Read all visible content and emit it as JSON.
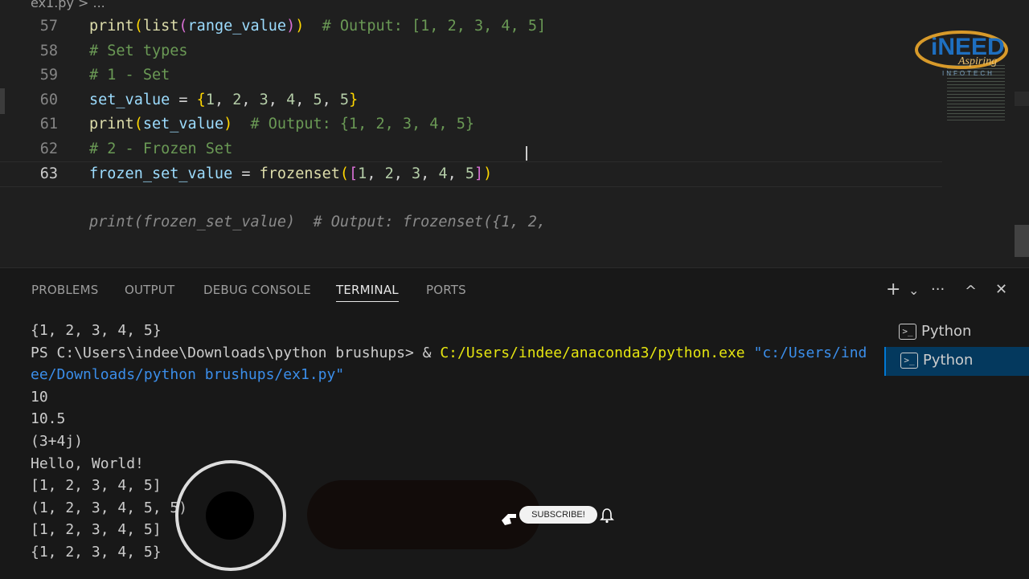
{
  "editor": {
    "tab_label": "ex1.py > ...",
    "lines": [
      {
        "n": "57",
        "segs": [
          [
            "fn",
            "print"
          ],
          [
            "p1",
            "("
          ],
          [
            "fn",
            "list"
          ],
          [
            "p2",
            "("
          ],
          [
            "var",
            "range_value"
          ],
          [
            "p2",
            ")"
          ],
          [
            "p1",
            ")"
          ],
          [
            "op",
            "  "
          ],
          [
            "cm",
            "# Output: [1, 2, 3, 4, 5]"
          ]
        ]
      },
      {
        "n": "58",
        "segs": [
          [
            "cm",
            "# Set types"
          ]
        ]
      },
      {
        "n": "59",
        "segs": [
          [
            "cm",
            "# 1 - Set"
          ]
        ]
      },
      {
        "n": "60",
        "segs": [
          [
            "var",
            "set_value"
          ],
          [
            "op",
            " = "
          ],
          [
            "p1",
            "{"
          ],
          [
            "num",
            "1"
          ],
          [
            "op",
            ", "
          ],
          [
            "num",
            "2"
          ],
          [
            "op",
            ", "
          ],
          [
            "num",
            "3"
          ],
          [
            "op",
            ", "
          ],
          [
            "num",
            "4"
          ],
          [
            "op",
            ", "
          ],
          [
            "num",
            "5"
          ],
          [
            "op",
            ", "
          ],
          [
            "num",
            "5"
          ],
          [
            "p1",
            "}"
          ]
        ]
      },
      {
        "n": "61",
        "segs": [
          [
            "fn",
            "print"
          ],
          [
            "p1",
            "("
          ],
          [
            "var",
            "set_value"
          ],
          [
            "p1",
            ")"
          ],
          [
            "op",
            "  "
          ],
          [
            "cm",
            "# Output: {1, 2, 3, 4, 5}"
          ]
        ]
      },
      {
        "n": "62",
        "segs": [
          [
            "cm",
            "# 2 - Frozen Set"
          ]
        ]
      },
      {
        "n": "63",
        "segs": [
          [
            "var",
            "frozen_set_value"
          ],
          [
            "op",
            " = "
          ],
          [
            "fn",
            "frozenset"
          ],
          [
            "p1",
            "("
          ],
          [
            "p2",
            "["
          ],
          [
            "num",
            "1"
          ],
          [
            "op",
            ", "
          ],
          [
            "num",
            "2"
          ],
          [
            "op",
            ", "
          ],
          [
            "num",
            "3"
          ],
          [
            "op",
            ", "
          ],
          [
            "num",
            "4"
          ],
          [
            "op",
            ", "
          ],
          [
            "num",
            "5"
          ],
          [
            "p2",
            "]"
          ],
          [
            "p1",
            ")"
          ]
        ]
      }
    ],
    "ghost_suggestion": "print(frozen_set_value)  # Output: frozenset({1, 2,"
  },
  "panel": {
    "tabs": [
      "PROBLEMS",
      "OUTPUT",
      "DEBUG CONSOLE",
      "TERMINAL",
      "PORTS"
    ],
    "active_tab": "TERMINAL",
    "actions": {
      "add": "+",
      "split_chevron": "⌄",
      "more": "···",
      "maximize": "^",
      "close": "✕"
    }
  },
  "terminal": {
    "lines": [
      {
        "t": "{1, 2, 3, 4, 5}"
      },
      {
        "ps": "PS C:\\Users\\indee\\Downloads\\python brushups> & ",
        "exe": "C:/Users/indee/anaconda3/python.exe ",
        "arg": "\"c:/Users/ind"
      },
      {
        "arg": "ee/Downloads/python brushups/ex1.py\""
      },
      {
        "t": "10"
      },
      {
        "t": "10.5"
      },
      {
        "t": "(3+4j)"
      },
      {
        "t": "Hello, World!"
      },
      {
        "t": "[1, 2, 3, 4, 5]"
      },
      {
        "t": "(1, 2, 3, 4, 5, 5)"
      },
      {
        "t": "[1, 2, 3, 4, 5]"
      },
      {
        "t": "{1, 2, 3, 4, 5}"
      }
    ],
    "sessions": [
      {
        "name": "Python",
        "selected": false
      },
      {
        "name": "Python",
        "selected": true
      }
    ]
  },
  "overlay": {
    "subscribe_label": "SUBSCRIBE!"
  },
  "logo": {
    "line1": "iNEED",
    "line2": "Aspiring",
    "line3": "INFOTECH"
  }
}
